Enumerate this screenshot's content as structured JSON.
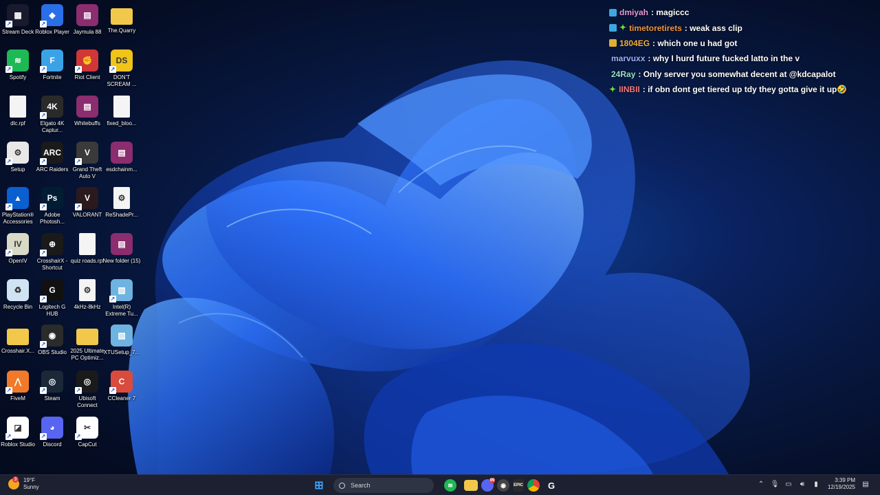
{
  "desktop": {
    "icons": [
      {
        "label": "Stream Deck",
        "icon": "stream-deck-icon",
        "color": "#1a1a2e",
        "glyph": "▦",
        "shortcut": true
      },
      {
        "label": "Roblox Player",
        "icon": "roblox-player-icon",
        "color": "#2b6fe8",
        "glyph": "◆",
        "shortcut": true
      },
      {
        "label": "Jaymula 88",
        "icon": "winrar-icon",
        "color": "#8b2d6e",
        "glyph": "▤",
        "shortcut": false
      },
      {
        "label": "The.Quarry",
        "icon": "folder-icon",
        "color": "#f2c84b",
        "glyph": "",
        "shortcut": false
      },
      {
        "label": "Spotify",
        "icon": "spotify-icon",
        "color": "#1db954",
        "glyph": "≋",
        "shortcut": true
      },
      {
        "label": "Fortnite",
        "icon": "fortnite-icon",
        "color": "#3aa3e8",
        "glyph": "F",
        "shortcut": true
      },
      {
        "label": "Riot Client",
        "icon": "riot-client-icon",
        "color": "#d13639",
        "glyph": "✊",
        "shortcut": true
      },
      {
        "label": "DON'T SCREAM ...",
        "icon": "dont-scream-icon",
        "color": "#f0c419",
        "glyph": "DS",
        "shortcut": true
      },
      {
        "label": "dlc.rpf",
        "icon": "file-icon",
        "color": "#f4f4f4",
        "glyph": "",
        "shortcut": false
      },
      {
        "label": "Elgato 4K Captur...",
        "icon": "elgato-4k-icon",
        "color": "#2a2a2a",
        "glyph": "4K",
        "shortcut": true
      },
      {
        "label": "Whitebuffs",
        "icon": "winrar-icon",
        "color": "#8b2d6e",
        "glyph": "▤",
        "shortcut": false
      },
      {
        "label": "fixed_bloo...",
        "icon": "file-icon",
        "color": "#f4f4f4",
        "glyph": "",
        "shortcut": false
      },
      {
        "label": "Setup",
        "icon": "setup-icon",
        "color": "#e8e8e8",
        "glyph": "⚙",
        "shortcut": true
      },
      {
        "label": "ARC Raiders",
        "icon": "arc-raiders-icon",
        "color": "#1a1a1a",
        "glyph": "ARC",
        "shortcut": true
      },
      {
        "label": "Grand Theft Auto V",
        "icon": "gta-v-icon",
        "color": "#3a3a3a",
        "glyph": "V",
        "shortcut": true
      },
      {
        "label": "esdchainm...",
        "icon": "winrar-icon",
        "color": "#8b2d6e",
        "glyph": "▤",
        "shortcut": false
      },
      {
        "label": "PlayStation® Accessories",
        "icon": "playstation-icon",
        "color": "#0a5fd1",
        "glyph": "▲",
        "shortcut": true
      },
      {
        "label": "Adobe Photosh...",
        "icon": "photoshop-icon",
        "color": "#001d34",
        "glyph": "Ps",
        "shortcut": true
      },
      {
        "label": "VALORANT",
        "icon": "valorant-icon",
        "color": "#2a1a1e",
        "glyph": "V",
        "shortcut": true
      },
      {
        "label": "ReShadePr...",
        "icon": "file-gear-icon",
        "color": "#f4f4f4",
        "glyph": "⚙",
        "shortcut": false
      },
      {
        "label": "OpenIV",
        "icon": "openiv-icon",
        "color": "#d9d9c8",
        "glyph": "IV",
        "shortcut": true
      },
      {
        "label": "CrosshairX - Shortcut",
        "icon": "crosshairx-icon",
        "color": "#1a1a1a",
        "glyph": "⊕",
        "shortcut": true
      },
      {
        "label": "quiz roads.rpf",
        "icon": "file-icon",
        "color": "#f4f4f4",
        "glyph": "",
        "shortcut": false
      },
      {
        "label": "New folder (15)",
        "icon": "winrar-icon",
        "color": "#8b2d6e",
        "glyph": "▤",
        "shortcut": false
      },
      {
        "label": "Recycle Bin",
        "icon": "recycle-bin-icon",
        "color": "#cfe3f2",
        "glyph": "♻",
        "shortcut": false
      },
      {
        "label": "Logitech G HUB",
        "icon": "logitech-g-icon",
        "color": "#111111",
        "glyph": "G",
        "shortcut": true
      },
      {
        "label": "4kHz-8kHz",
        "icon": "file-gear-icon",
        "color": "#f4f4f4",
        "glyph": "⚙",
        "shortcut": false
      },
      {
        "label": "Intel(R) Extreme Tu...",
        "icon": "intel-xtu-icon",
        "color": "#6fb3e0",
        "glyph": "▧",
        "shortcut": true
      },
      {
        "label": "Crosshair.X...",
        "icon": "folder-icon",
        "color": "#f2c84b",
        "glyph": "",
        "shortcut": false
      },
      {
        "label": "OBS Studio",
        "icon": "obs-studio-icon",
        "color": "#2b2b2b",
        "glyph": "◉",
        "shortcut": true
      },
      {
        "label": "2025 Ultimate PC Optimiz...",
        "icon": "folder-icon",
        "color": "#f2c84b",
        "glyph": "",
        "shortcut": false
      },
      {
        "label": "XTUSetup_7...",
        "icon": "installer-icon",
        "color": "#6fb3e0",
        "glyph": "▧",
        "shortcut": false
      },
      {
        "label": "FiveM",
        "icon": "fivem-icon",
        "color": "#f07a2a",
        "glyph": "⋀",
        "shortcut": true
      },
      {
        "label": "Steam",
        "icon": "steam-icon",
        "color": "#1b2838",
        "glyph": "◎",
        "shortcut": true
      },
      {
        "label": "Ubisoft Connect",
        "icon": "ubisoft-icon",
        "color": "#1a1a1a",
        "glyph": "◎",
        "shortcut": true
      },
      {
        "label": "CCleaner 7",
        "icon": "ccleaner-icon",
        "color": "#d94b3c",
        "glyph": "C",
        "shortcut": true
      },
      {
        "label": "Roblox Studio",
        "icon": "roblox-studio-icon",
        "color": "#ffffff",
        "glyph": "◪",
        "shortcut": true
      },
      {
        "label": "Discord",
        "icon": "discord-icon",
        "color": "#5865f2",
        "glyph": "◕",
        "shortcut": true
      },
      {
        "label": "CapCut",
        "icon": "capcut-icon",
        "color": "#ffffff",
        "glyph": "✂",
        "shortcut": true
      }
    ]
  },
  "chat": {
    "messages": [
      {
        "badges": [
          "blue"
        ],
        "user": "dmiyah",
        "user_color": "#e49ad9",
        "text": ": magiccc"
      },
      {
        "badges": [
          "blue",
          "green"
        ],
        "user": "timetoretirets",
        "user_color": "#f0953a",
        "text": ": weak ass clip"
      },
      {
        "badges": [
          "gold"
        ],
        "user": "1804EG",
        "user_color": "#f0b040",
        "text": ": which one u had got"
      },
      {
        "badges": [],
        "user": "marvuxx",
        "user_color": "#9bb0ff",
        "text": ": why I hurd future fucked latto in the v"
      },
      {
        "badges": [],
        "user": "24Ray",
        "user_color": "#9de0c6",
        "text": ": Only server you somewhat decent at @kdcapalot"
      },
      {
        "badges": [
          "green"
        ],
        "user": "IINBII",
        "user_color": "#f07a7a",
        "text": ": if obn dont get tiered up tdy they gotta give it up🤣"
      }
    ]
  },
  "taskbar": {
    "weather": {
      "temp": "19°F",
      "condition": "Sunny",
      "badge": "3"
    },
    "search_label": "Search",
    "discord_badge": "99",
    "clock": {
      "time": "3:39 PM",
      "date": "12/19/2025"
    },
    "apps": [
      {
        "name": "start-button",
        "glyph": "⊞",
        "color": "#3aa0ff"
      },
      {
        "name": "spotify-taskbar-icon",
        "glyph": "≋",
        "color": "#1db954"
      },
      {
        "name": "file-explorer-taskbar-icon",
        "glyph": "▬",
        "color": "#f2c84b"
      },
      {
        "name": "discord-taskbar-icon",
        "glyph": "◕",
        "color": "#5865f2"
      },
      {
        "name": "obs-taskbar-icon",
        "glyph": "◉",
        "color": "#444444"
      },
      {
        "name": "epic-games-taskbar-icon",
        "glyph": "EPIC",
        "color": "#2a2a2a"
      },
      {
        "name": "chrome-taskbar-icon",
        "glyph": "◍",
        "color": "#dd4b39"
      },
      {
        "name": "logitech-g-taskbar-icon",
        "glyph": "G",
        "color": "#1c2030"
      }
    ]
  }
}
